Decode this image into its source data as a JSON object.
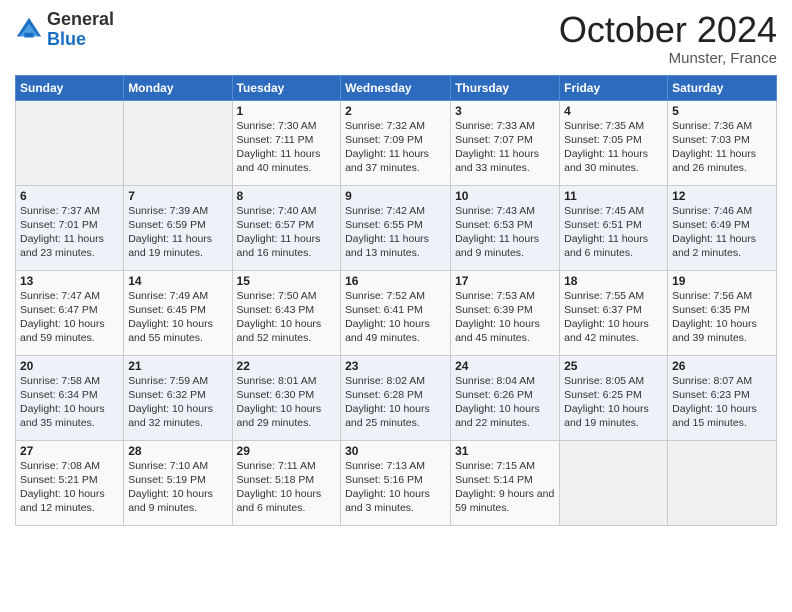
{
  "header": {
    "logo_general": "General",
    "logo_blue": "Blue",
    "month_title": "October 2024",
    "location": "Munster, France"
  },
  "days_of_week": [
    "Sunday",
    "Monday",
    "Tuesday",
    "Wednesday",
    "Thursday",
    "Friday",
    "Saturday"
  ],
  "weeks": [
    [
      {
        "day": "",
        "sunrise": "",
        "sunset": "",
        "daylight": ""
      },
      {
        "day": "",
        "sunrise": "",
        "sunset": "",
        "daylight": ""
      },
      {
        "day": "1",
        "sunrise": "Sunrise: 7:30 AM",
        "sunset": "Sunset: 7:11 PM",
        "daylight": "Daylight: 11 hours and 40 minutes."
      },
      {
        "day": "2",
        "sunrise": "Sunrise: 7:32 AM",
        "sunset": "Sunset: 7:09 PM",
        "daylight": "Daylight: 11 hours and 37 minutes."
      },
      {
        "day": "3",
        "sunrise": "Sunrise: 7:33 AM",
        "sunset": "Sunset: 7:07 PM",
        "daylight": "Daylight: 11 hours and 33 minutes."
      },
      {
        "day": "4",
        "sunrise": "Sunrise: 7:35 AM",
        "sunset": "Sunset: 7:05 PM",
        "daylight": "Daylight: 11 hours and 30 minutes."
      },
      {
        "day": "5",
        "sunrise": "Sunrise: 7:36 AM",
        "sunset": "Sunset: 7:03 PM",
        "daylight": "Daylight: 11 hours and 26 minutes."
      }
    ],
    [
      {
        "day": "6",
        "sunrise": "Sunrise: 7:37 AM",
        "sunset": "Sunset: 7:01 PM",
        "daylight": "Daylight: 11 hours and 23 minutes."
      },
      {
        "day": "7",
        "sunrise": "Sunrise: 7:39 AM",
        "sunset": "Sunset: 6:59 PM",
        "daylight": "Daylight: 11 hours and 19 minutes."
      },
      {
        "day": "8",
        "sunrise": "Sunrise: 7:40 AM",
        "sunset": "Sunset: 6:57 PM",
        "daylight": "Daylight: 11 hours and 16 minutes."
      },
      {
        "day": "9",
        "sunrise": "Sunrise: 7:42 AM",
        "sunset": "Sunset: 6:55 PM",
        "daylight": "Daylight: 11 hours and 13 minutes."
      },
      {
        "day": "10",
        "sunrise": "Sunrise: 7:43 AM",
        "sunset": "Sunset: 6:53 PM",
        "daylight": "Daylight: 11 hours and 9 minutes."
      },
      {
        "day": "11",
        "sunrise": "Sunrise: 7:45 AM",
        "sunset": "Sunset: 6:51 PM",
        "daylight": "Daylight: 11 hours and 6 minutes."
      },
      {
        "day": "12",
        "sunrise": "Sunrise: 7:46 AM",
        "sunset": "Sunset: 6:49 PM",
        "daylight": "Daylight: 11 hours and 2 minutes."
      }
    ],
    [
      {
        "day": "13",
        "sunrise": "Sunrise: 7:47 AM",
        "sunset": "Sunset: 6:47 PM",
        "daylight": "Daylight: 10 hours and 59 minutes."
      },
      {
        "day": "14",
        "sunrise": "Sunrise: 7:49 AM",
        "sunset": "Sunset: 6:45 PM",
        "daylight": "Daylight: 10 hours and 55 minutes."
      },
      {
        "day": "15",
        "sunrise": "Sunrise: 7:50 AM",
        "sunset": "Sunset: 6:43 PM",
        "daylight": "Daylight: 10 hours and 52 minutes."
      },
      {
        "day": "16",
        "sunrise": "Sunrise: 7:52 AM",
        "sunset": "Sunset: 6:41 PM",
        "daylight": "Daylight: 10 hours and 49 minutes."
      },
      {
        "day": "17",
        "sunrise": "Sunrise: 7:53 AM",
        "sunset": "Sunset: 6:39 PM",
        "daylight": "Daylight: 10 hours and 45 minutes."
      },
      {
        "day": "18",
        "sunrise": "Sunrise: 7:55 AM",
        "sunset": "Sunset: 6:37 PM",
        "daylight": "Daylight: 10 hours and 42 minutes."
      },
      {
        "day": "19",
        "sunrise": "Sunrise: 7:56 AM",
        "sunset": "Sunset: 6:35 PM",
        "daylight": "Daylight: 10 hours and 39 minutes."
      }
    ],
    [
      {
        "day": "20",
        "sunrise": "Sunrise: 7:58 AM",
        "sunset": "Sunset: 6:34 PM",
        "daylight": "Daylight: 10 hours and 35 minutes."
      },
      {
        "day": "21",
        "sunrise": "Sunrise: 7:59 AM",
        "sunset": "Sunset: 6:32 PM",
        "daylight": "Daylight: 10 hours and 32 minutes."
      },
      {
        "day": "22",
        "sunrise": "Sunrise: 8:01 AM",
        "sunset": "Sunset: 6:30 PM",
        "daylight": "Daylight: 10 hours and 29 minutes."
      },
      {
        "day": "23",
        "sunrise": "Sunrise: 8:02 AM",
        "sunset": "Sunset: 6:28 PM",
        "daylight": "Daylight: 10 hours and 25 minutes."
      },
      {
        "day": "24",
        "sunrise": "Sunrise: 8:04 AM",
        "sunset": "Sunset: 6:26 PM",
        "daylight": "Daylight: 10 hours and 22 minutes."
      },
      {
        "day": "25",
        "sunrise": "Sunrise: 8:05 AM",
        "sunset": "Sunset: 6:25 PM",
        "daylight": "Daylight: 10 hours and 19 minutes."
      },
      {
        "day": "26",
        "sunrise": "Sunrise: 8:07 AM",
        "sunset": "Sunset: 6:23 PM",
        "daylight": "Daylight: 10 hours and 15 minutes."
      }
    ],
    [
      {
        "day": "27",
        "sunrise": "Sunrise: 7:08 AM",
        "sunset": "Sunset: 5:21 PM",
        "daylight": "Daylight: 10 hours and 12 minutes."
      },
      {
        "day": "28",
        "sunrise": "Sunrise: 7:10 AM",
        "sunset": "Sunset: 5:19 PM",
        "daylight": "Daylight: 10 hours and 9 minutes."
      },
      {
        "day": "29",
        "sunrise": "Sunrise: 7:11 AM",
        "sunset": "Sunset: 5:18 PM",
        "daylight": "Daylight: 10 hours and 6 minutes."
      },
      {
        "day": "30",
        "sunrise": "Sunrise: 7:13 AM",
        "sunset": "Sunset: 5:16 PM",
        "daylight": "Daylight: 10 hours and 3 minutes."
      },
      {
        "day": "31",
        "sunrise": "Sunrise: 7:15 AM",
        "sunset": "Sunset: 5:14 PM",
        "daylight": "Daylight: 9 hours and 59 minutes."
      },
      {
        "day": "",
        "sunrise": "",
        "sunset": "",
        "daylight": ""
      },
      {
        "day": "",
        "sunrise": "",
        "sunset": "",
        "daylight": ""
      }
    ]
  ]
}
